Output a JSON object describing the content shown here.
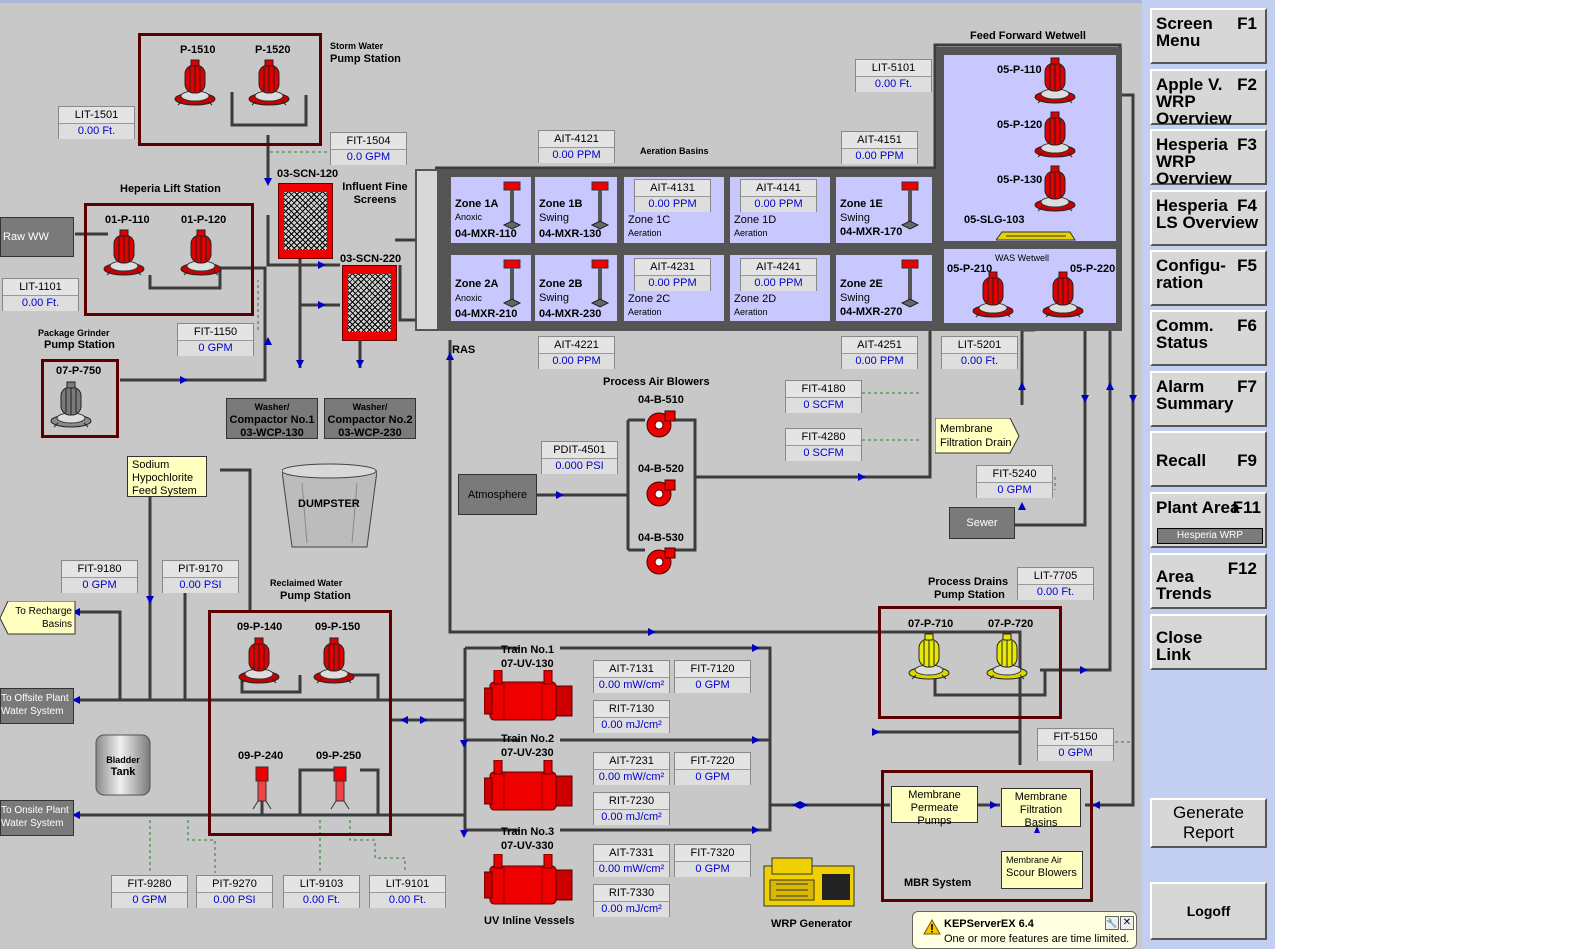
{
  "header": {
    "feed_forward_wetwell": "Feed Forward Wetwell",
    "aeration_basins": "Aeration Basins"
  },
  "storm": {
    "title_small": "Storm Water",
    "title": "Pump Station",
    "pump1": "P-1510",
    "pump2": "P-1520"
  },
  "lit1501": {
    "tag": "LIT-1501",
    "value": "0.00",
    "unit": "Ft."
  },
  "fit1504": {
    "tag": "FIT-1504",
    "value": "0.0",
    "unit": "GPM"
  },
  "heperia": {
    "title": "Heperia Lift Station",
    "pump1": "01-P-110",
    "pump2": "01-P-120"
  },
  "raw_ww": "Raw WW",
  "lit1101": {
    "tag": "LIT-1101",
    "value": "0.00",
    "unit": "Ft."
  },
  "fit1150": {
    "tag": "FIT-1150",
    "value": "0",
    "unit": "GPM"
  },
  "grinder": {
    "title_small": "Package Grinder",
    "title": "Pump Station",
    "pump": "07-P-750"
  },
  "screens": {
    "title": "Influent Fine Screens",
    "scn1": "03-SCN-120",
    "scn2": "03-SCN-220"
  },
  "compactor1": {
    "l1": "Washer/",
    "l2": "Compactor No.1",
    "l3": "03-WCP-130"
  },
  "compactor2": {
    "l1": "Washer/",
    "l2": "Compactor No.2",
    "l3": "03-WCP-230"
  },
  "dumpster": "DUMPSTER",
  "sodium": {
    "l1": "Sodium",
    "l2": "Hypochlorite",
    "l3": "Feed System"
  },
  "fit9180": {
    "tag": "FIT-9180",
    "value": "0",
    "unit": "GPM"
  },
  "pit9170": {
    "tag": "PIT-9170",
    "value": "0.00",
    "unit": "PSI"
  },
  "recharge": {
    "l1": "To Recharge",
    "l2": "Basins"
  },
  "offsite": {
    "l1": "To Offsite Plant",
    "l2": "Water System"
  },
  "onsite": {
    "l1": "To Onsite Plant",
    "l2": "Water System"
  },
  "bladder": {
    "l1": "Bladder",
    "l2": "Tank"
  },
  "reclaimed": {
    "title_small": "Reclaimed Water",
    "title": "Pump Station",
    "p1": "09-P-140",
    "p2": "09-P-150",
    "p3": "09-P-240",
    "p4": "09-P-250"
  },
  "bottom_inst": [
    {
      "tag": "FIT-9280",
      "value": "0",
      "unit": "GPM"
    },
    {
      "tag": "PIT-9270",
      "value": "0.00",
      "unit": "PSI"
    },
    {
      "tag": "LIT-9103",
      "value": "0.00",
      "unit": "Ft."
    },
    {
      "tag": "LIT-9101",
      "value": "0.00",
      "unit": "Ft."
    }
  ],
  "ait4121": {
    "tag": "AIT-4121",
    "value": "0.00",
    "unit": "PPM"
  },
  "ait4151": {
    "tag": "AIT-4151",
    "value": "0.00",
    "unit": "PPM"
  },
  "ait4221": {
    "tag": "AIT-4221",
    "value": "0.00",
    "unit": "PPM"
  },
  "ait4251": {
    "tag": "AIT-4251",
    "value": "0.00",
    "unit": "PPM"
  },
  "ait4131": {
    "tag": "AIT-4131",
    "value": "0.00",
    "unit": "PPM"
  },
  "ait4141": {
    "tag": "AIT-4141",
    "value": "0.00",
    "unit": "PPM"
  },
  "ait4231": {
    "tag": "AIT-4231",
    "value": "0.00",
    "unit": "PPM"
  },
  "ait4241": {
    "tag": "AIT-4241",
    "value": "0.00",
    "unit": "PPM"
  },
  "zones": {
    "z1a": {
      "name": "Zone 1A",
      "sub": "Anoxic",
      "mixer": "04-MXR-110"
    },
    "z1b": {
      "name": "Zone 1B",
      "sub": "Swing",
      "mixer": "04-MXR-130"
    },
    "z1c": {
      "name": "Zone 1C",
      "sub": "Aeration"
    },
    "z1d": {
      "name": "Zone 1D",
      "sub": "Aeration"
    },
    "z1e": {
      "name": "Zone 1E",
      "sub": "Swing",
      "mixer": "04-MXR-170"
    },
    "z2a": {
      "name": "Zone 2A",
      "sub": "Anoxic",
      "mixer": "04-MXR-210"
    },
    "z2b": {
      "name": "Zone 2B",
      "sub": "Swing",
      "mixer": "04-MXR-230"
    },
    "z2c": {
      "name": "Zone 2C",
      "sub": "Aeration"
    },
    "z2d": {
      "name": "Zone 2D",
      "sub": "Aeration"
    },
    "z2e": {
      "name": "Zone 2E",
      "sub": "Swing",
      "mixer": "04-MXR-270"
    }
  },
  "ras": "RAS",
  "lit5101": {
    "tag": "LIT-5101",
    "value": "0.00",
    "unit": "Ft."
  },
  "wetwell": {
    "p1": "05-P-110",
    "p2": "05-P-120",
    "p3": "05-P-130",
    "slg": "05-SLG-103",
    "was": "WAS Wetwell",
    "p4": "05-P-210",
    "p5": "05-P-220"
  },
  "lit5201": {
    "tag": "LIT-5201",
    "value": "0.00",
    "unit": "Ft."
  },
  "blowers": {
    "title": "Process Air Blowers",
    "b1": "04-B-510",
    "b2": "04-B-520",
    "b3": "04-B-530"
  },
  "pdit4501": {
    "tag": "PDIT-4501",
    "value": "0.000",
    "unit": "PSI"
  },
  "atmosphere": "Atmosphere",
  "fit4180": {
    "tag": "FIT-4180",
    "value": "0",
    "unit": "SCFM"
  },
  "fit4280": {
    "tag": "FIT-4280",
    "value": "0",
    "unit": "SCFM"
  },
  "membrane_drain": {
    "l1": "Membrane",
    "l2": "Filtration Drain"
  },
  "fit5240": {
    "tag": "FIT-5240",
    "value": "0",
    "unit": "GPM"
  },
  "sewer": "Sewer",
  "drains": {
    "title": "Process Drains",
    "title2": "Pump Station",
    "p1": "07-P-710",
    "p2": "07-P-720"
  },
  "lit7705": {
    "tag": "LIT-7705",
    "value": "0.00",
    "unit": "Ft."
  },
  "uv": {
    "t1": "Train No.1",
    "t1id": "07-UV-130",
    "t2": "Train No.2",
    "t2id": "07-UV-230",
    "t3": "Train No.3",
    "t3id": "07-UV-330",
    "title": "UV Inline Vessels"
  },
  "uv_inst": [
    {
      "tag": "AIT-7131",
      "value": "0.00",
      "unit": "mW/cm²"
    },
    {
      "tag": "FIT-7120",
      "value": "0",
      "unit": "GPM"
    },
    {
      "tag": "RIT-7130",
      "value": "0.00",
      "unit": "mJ/cm²"
    },
    {
      "tag": "AIT-7231",
      "value": "0.00",
      "unit": "mW/cm²"
    },
    {
      "tag": "FIT-7220",
      "value": "0",
      "unit": "GPM"
    },
    {
      "tag": "RIT-7230",
      "value": "0.00",
      "unit": "mJ/cm²"
    },
    {
      "tag": "AIT-7331",
      "value": "0.00",
      "unit": "mW/cm²"
    },
    {
      "tag": "FIT-7320",
      "value": "0",
      "unit": "GPM"
    },
    {
      "tag": "RIT-7330",
      "value": "0.00",
      "unit": "mJ/cm²"
    }
  ],
  "generator": "WRP Generator",
  "fit5150": {
    "tag": "FIT-5150",
    "value": "0",
    "unit": "GPM"
  },
  "mbr": {
    "title": "MBR System",
    "permeate1": "Membrane",
    "permeate2": "Permeate Pumps",
    "basins1": "Membrane",
    "basins2": "Filtration Basins",
    "scour1": "Membrane Air",
    "scour2": "Scour Blowers"
  },
  "kep": {
    "title": "KEPServerEX 6.4",
    "msg": "One or more features are time limited."
  },
  "sidebar": {
    "b1": {
      "label": "Screen\nMenu",
      "key": "F1"
    },
    "b2": {
      "label": "Apple V.\nWRP Overview",
      "key": "F2"
    },
    "b3": {
      "label": "Hesperia\nWRP Overview",
      "key": "F3"
    },
    "b4": {
      "label": "Hesperia\nLS Overview",
      "key": "F4"
    },
    "b5": {
      "label": "Configu-\nration",
      "key": "F5"
    },
    "b6": {
      "label": "Comm.\nStatus",
      "key": "F6"
    },
    "b7": {
      "label": "Alarm\nSummary",
      "key": "F7"
    },
    "b8": {
      "label": "Recall",
      "key": "F9"
    },
    "b9": {
      "label": "Plant Area",
      "key": "F11",
      "sub": "Hesperia WRP"
    },
    "b10": {
      "label": "Area\nTrends",
      "key": "F12"
    },
    "b11": {
      "label": "Close\nLink",
      "key": ""
    },
    "generate": "Generate\nReport",
    "logoff": "Logoff"
  }
}
